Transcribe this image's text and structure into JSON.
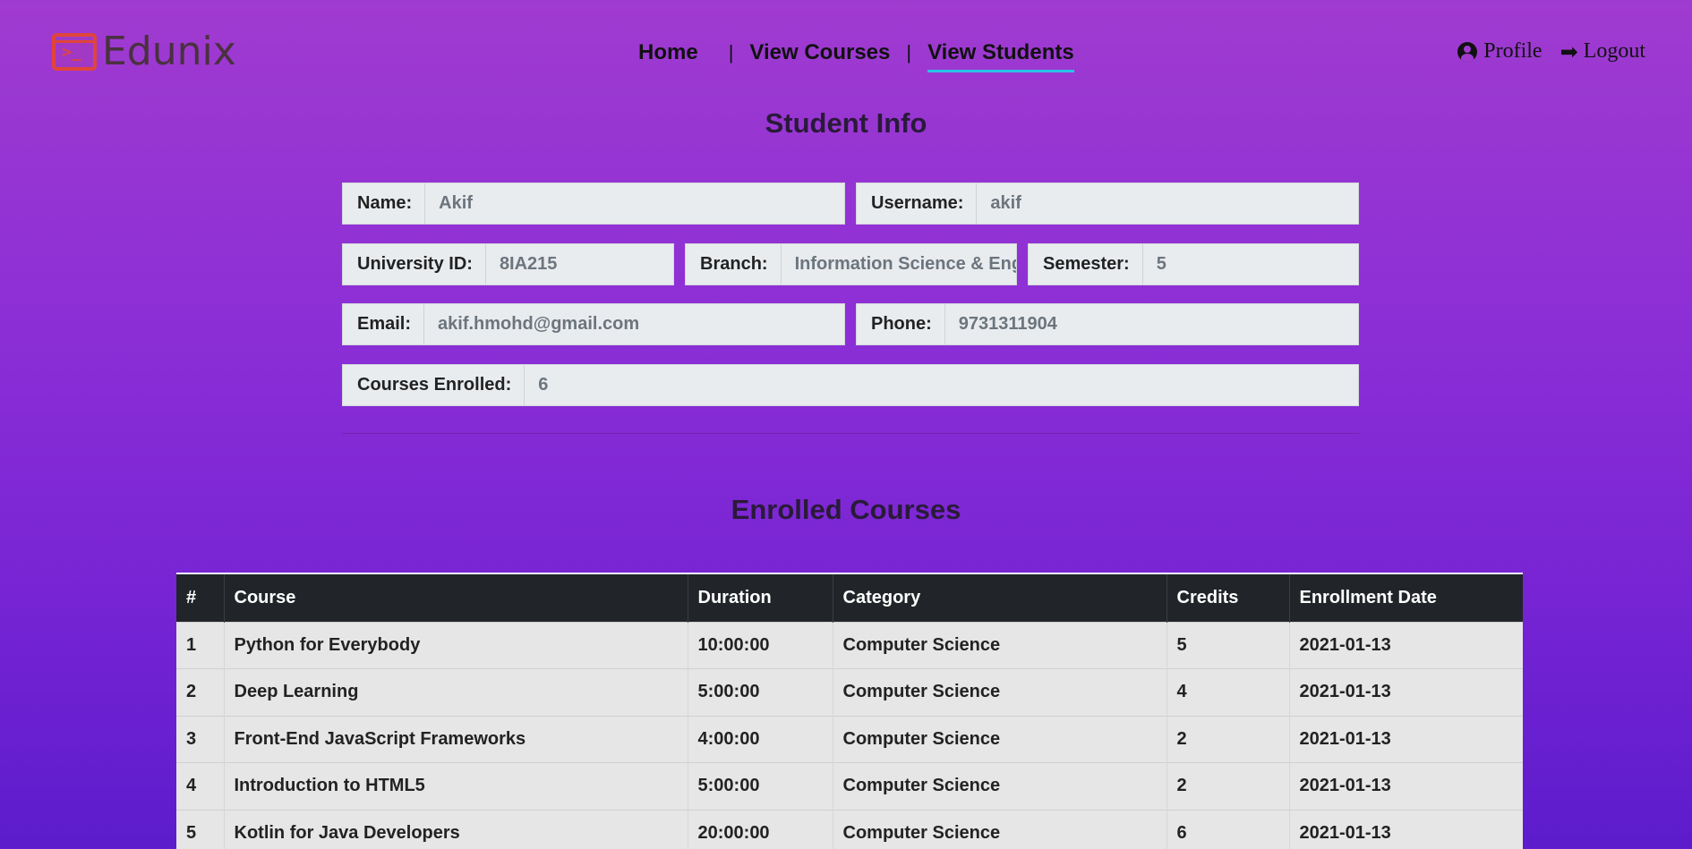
{
  "brand": {
    "logo_prompt": ">_",
    "name": "Edunix",
    "accent": "#e0453a"
  },
  "nav": {
    "items": [
      {
        "label": "Home"
      },
      {
        "label": "View Courses"
      },
      {
        "label": "View Students",
        "active": true
      }
    ],
    "separator": "|",
    "profile_label": "Profile",
    "logout_label": "Logout",
    "active_underline_color": "#29c4e8"
  },
  "student_info": {
    "title": "Student Info",
    "name": {
      "label": "Name:",
      "value": "Akif"
    },
    "username": {
      "label": "Username:",
      "value": "akif"
    },
    "university_id": {
      "label": "University ID:",
      "value": "8IA215"
    },
    "branch": {
      "label": "Branch:",
      "value": "Information Science & Eng"
    },
    "semester": {
      "label": "Semester:",
      "value": "5"
    },
    "email": {
      "label": "Email:",
      "value": "akif.hmohd@gmail.com"
    },
    "phone": {
      "label": "Phone:",
      "value": "9731311904"
    },
    "courses_enrolled": {
      "label": "Courses Enrolled:",
      "value": "6"
    }
  },
  "enrolled_courses": {
    "title": "Enrolled Courses",
    "columns": [
      "#",
      "Course",
      "Duration",
      "Category",
      "Credits",
      "Enrollment Date"
    ],
    "rows": [
      [
        "1",
        "Python for Everybody",
        "10:00:00",
        "Computer Science",
        "5",
        "2021-01-13"
      ],
      [
        "2",
        "Deep Learning",
        "5:00:00",
        "Computer Science",
        "4",
        "2021-01-13"
      ],
      [
        "3",
        "Front-End JavaScript Frameworks",
        "4:00:00",
        "Computer Science",
        "2",
        "2021-01-13"
      ],
      [
        "4",
        "Introduction to HTML5",
        "5:00:00",
        "Computer Science",
        "2",
        "2021-01-13"
      ],
      [
        "5",
        "Kotlin for Java Developers",
        "20:00:00",
        "Computer Science",
        "6",
        "2021-01-13"
      ]
    ]
  }
}
